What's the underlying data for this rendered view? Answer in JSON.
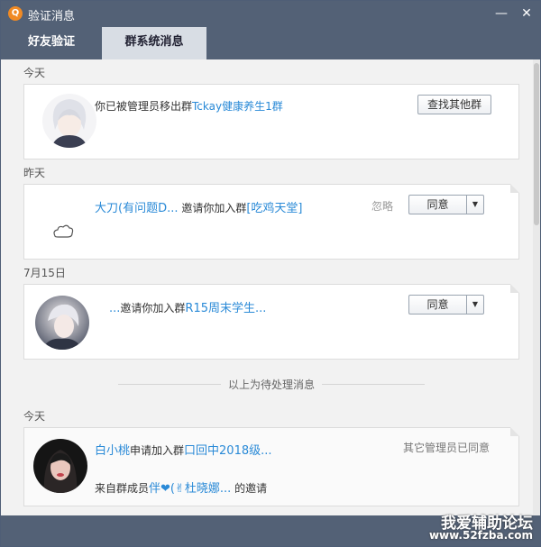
{
  "window": {
    "title": "验证消息",
    "app_icon_glyph": "Q",
    "minimize_glyph": "—",
    "close_glyph": "✕"
  },
  "tabs": [
    {
      "label": "好友验证",
      "active": false
    },
    {
      "label": "群系统消息",
      "active": true
    }
  ],
  "pending": [
    {
      "date": "今天",
      "msg_prefix": "你已被管理员移出群",
      "group": "Tckay健康养生1群",
      "button_label": "查找其他群"
    },
    {
      "date": "昨天",
      "user": "大刀(有问题D...",
      "msg_middle": "邀请你加入群",
      "group": "[吃鸡天堂]",
      "ignore_label": "忽略",
      "accept_label": "同意",
      "dropdown_glyph": "▼"
    },
    {
      "date": "7月15日",
      "user": "...",
      "msg_middle": "邀请你加入群",
      "group": "R15周末学生...",
      "accept_label": "同意",
      "dropdown_glyph": "▼"
    }
  ],
  "divider_text": "以上为待处理消息",
  "processed": [
    {
      "date": "今天",
      "user": "白小桃",
      "msg_middle": "申请加入群",
      "group": "口回中2018级...",
      "status": "其它管理员已同意",
      "source_prefix": "来自群成员",
      "inviter": "伴❤(✌杜晓娜...",
      "source_suffix": "的邀请"
    }
  ],
  "watermark": {
    "line1": "我爱辅助论坛",
    "line2": "www.52fzba.com"
  },
  "colors": {
    "titlebar": "#536176",
    "link": "#2a8ad7",
    "accent_icon": "#f08a24"
  }
}
